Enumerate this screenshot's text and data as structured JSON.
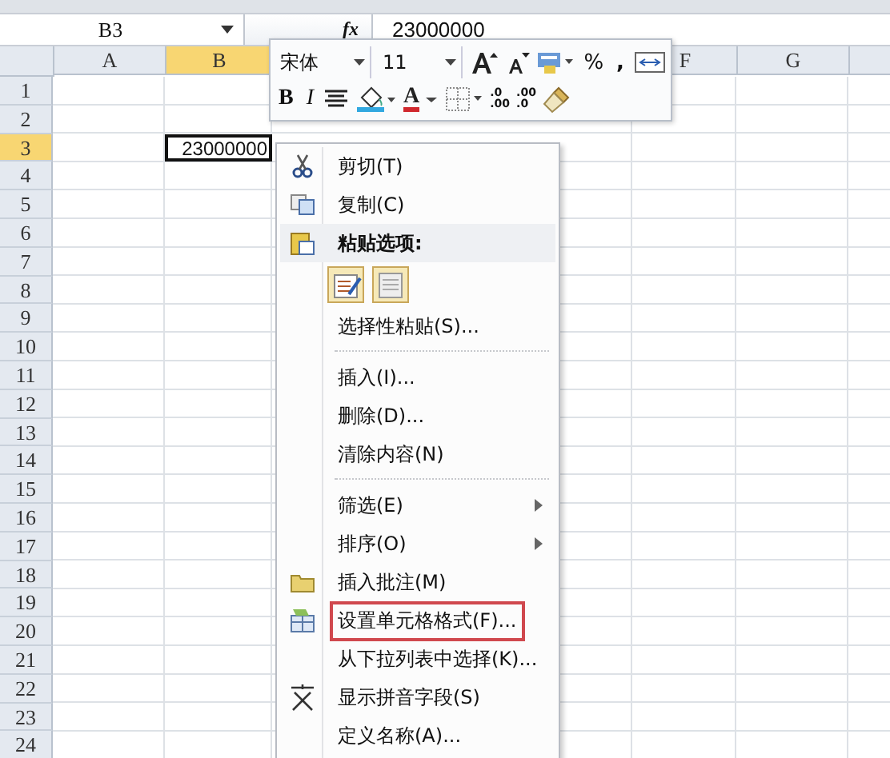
{
  "formula_bar": {
    "name_box": "B3",
    "fx": "fx",
    "value": "23000000"
  },
  "columns": [
    {
      "label": "A",
      "selected": false
    },
    {
      "label": "B",
      "selected": true
    },
    {
      "label": "F",
      "selected": false
    },
    {
      "label": "G",
      "selected": false
    },
    {
      "selected": false
    }
  ],
  "rows": [
    {
      "label": "1",
      "selected": false
    },
    {
      "label": "2",
      "selected": false
    },
    {
      "label": "3",
      "selected": true,
      "cells": {
        "1": "23000000"
      }
    },
    {
      "label": "4",
      "selected": false
    },
    {
      "label": "5",
      "selected": false
    },
    {
      "label": "6",
      "selected": false
    },
    {
      "label": "7",
      "selected": false
    },
    {
      "label": "8",
      "selected": false
    },
    {
      "label": "9",
      "selected": false
    },
    {
      "label": "10",
      "selected": false
    },
    {
      "label": "11",
      "selected": false
    },
    {
      "label": "12",
      "selected": false
    },
    {
      "label": "13",
      "selected": false
    },
    {
      "label": "14",
      "selected": false
    },
    {
      "label": "15",
      "selected": false
    },
    {
      "label": "16",
      "selected": false
    },
    {
      "label": "17",
      "selected": false
    },
    {
      "label": "18",
      "selected": false
    },
    {
      "label": "19",
      "selected": false
    },
    {
      "label": "20",
      "selected": false
    },
    {
      "label": "21",
      "selected": false
    },
    {
      "label": "22",
      "selected": false
    },
    {
      "label": "23",
      "selected": false
    },
    {
      "label": "24",
      "selected": false
    }
  ],
  "mini_toolbar": {
    "font": "宋体",
    "size": "11",
    "percent": "%",
    "comma": ",",
    "bold": "B",
    "italic": "I",
    "font_color": "A",
    "increase_decimal": [
      ".0",
      ".00"
    ],
    "decrease_decimal": [
      ".00",
      ".0"
    ]
  },
  "context_menu": [
    {
      "kind": "item",
      "label": "剪切(T)"
    },
    {
      "kind": "item",
      "label": "复制(C)"
    },
    {
      "kind": "header",
      "label": "粘贴选项:"
    },
    {
      "kind": "paste-icons"
    },
    {
      "kind": "item",
      "label": "选择性粘贴(S)..."
    },
    {
      "kind": "separator"
    },
    {
      "kind": "item",
      "label": "插入(I)..."
    },
    {
      "kind": "item",
      "label": "删除(D)..."
    },
    {
      "kind": "item",
      "label": "清除内容(N)"
    },
    {
      "kind": "separator"
    },
    {
      "kind": "item",
      "label": "筛选(E)",
      "submenu": true
    },
    {
      "kind": "item",
      "label": "排序(O)",
      "submenu": true
    },
    {
      "kind": "item",
      "label": "插入批注(M)"
    },
    {
      "kind": "item",
      "label": "设置单元格格式(F)...",
      "outlined": true
    },
    {
      "kind": "item",
      "label": "从下拉列表中选择(K)..."
    },
    {
      "kind": "item",
      "label": "显示拼音字段(S)"
    },
    {
      "kind": "item",
      "label": "定义名称(A)..."
    }
  ]
}
